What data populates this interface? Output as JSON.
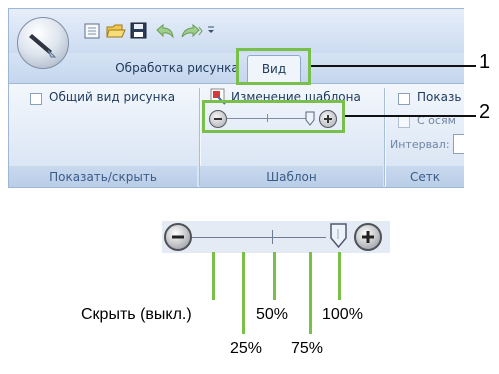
{
  "ribbon": {
    "tabs": [
      "Обработка рисунка",
      "Вид"
    ],
    "groups": {
      "show_hide": {
        "checkbox_label": "Общий вид рисунка",
        "caption": "Показать/скрыть"
      },
      "template": {
        "title": "Изменение шаблона",
        "caption": "Шаблон",
        "zoom_value": 1.0
      },
      "grid": {
        "checkbox_label": "Показь",
        "axis_label": "С осям",
        "interval_label": "Интервал:",
        "caption": "Сетк"
      }
    }
  },
  "callouts": {
    "tab": "1",
    "zoom": "2"
  },
  "zoom_legend": {
    "labels": [
      "Скрыть (выкл.)",
      "25%",
      "50%",
      "75%",
      "100%"
    ]
  },
  "colors": {
    "highlight": "#79c04a",
    "ribbon": "#c6d9f0",
    "text": "#1e395b"
  },
  "icons": [
    "app-button-icon",
    "new-icon",
    "open-icon",
    "save-icon",
    "undo-icon",
    "redo-icon",
    "dropdown-icon",
    "template-icon",
    "zoom-out-icon",
    "zoom-in-icon",
    "slider-thumb-icon"
  ]
}
